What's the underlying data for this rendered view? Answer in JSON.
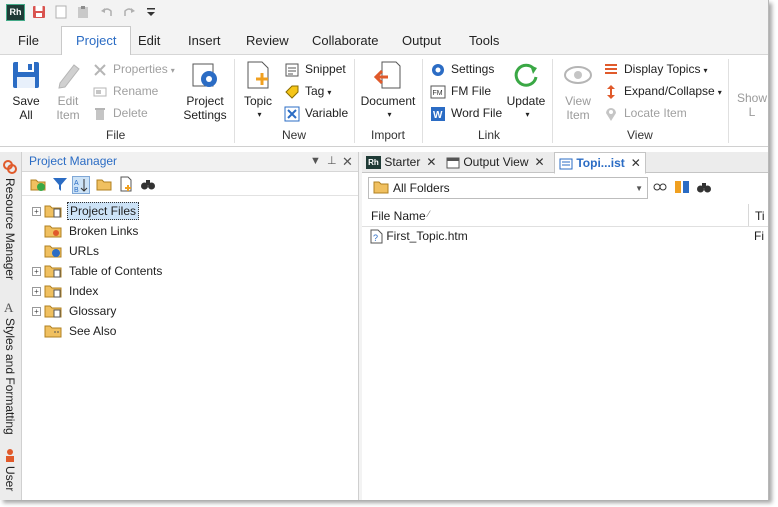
{
  "app": {
    "logo_text": "Rh"
  },
  "menu": {
    "tabs": [
      "File",
      "Project",
      "Edit",
      "Insert",
      "Review",
      "Collaborate",
      "Output",
      "Tools"
    ],
    "active": "Project"
  },
  "ribbon": {
    "file_group": {
      "label": "File",
      "save_all": [
        "Save",
        "All"
      ],
      "edit_item": [
        "Edit",
        "Item"
      ],
      "properties": "Properties",
      "rename": "Rename",
      "delete": "Delete",
      "project_settings": [
        "Project",
        "Settings"
      ]
    },
    "new_group": {
      "label": "New",
      "topic": "Topic",
      "snippet": "Snippet",
      "tag": "Tag",
      "variable": "Variable"
    },
    "import_group": {
      "label": "Import",
      "document": "Document"
    },
    "link_group": {
      "label": "Link",
      "settings": "Settings",
      "fm_file": "FM File",
      "word_file": "Word File",
      "update": "Update"
    },
    "view_group": {
      "label": "View",
      "view_item": [
        "View",
        "Item"
      ],
      "display_topics": "Display Topics",
      "expand_collapse": "Expand/Collapse",
      "locate_item": "Locate Item"
    },
    "overflow_label": [
      "Show",
      "L"
    ]
  },
  "sidebar": {
    "tabs": [
      "Resource Manager",
      "Styles and Formatting",
      "User"
    ]
  },
  "project_manager": {
    "title": "Project Manager",
    "tree": [
      {
        "label": "Project Files",
        "expandable": true,
        "selected": true
      },
      {
        "label": "Broken Links",
        "expandable": false,
        "selected": false
      },
      {
        "label": "URLs",
        "expandable": false,
        "selected": false
      },
      {
        "label": "Table of Contents",
        "expandable": true,
        "selected": false
      },
      {
        "label": "Index",
        "expandable": true,
        "selected": false
      },
      {
        "label": "Glossary",
        "expandable": true,
        "selected": false
      },
      {
        "label": "See Also",
        "expandable": false,
        "selected": false
      }
    ]
  },
  "doc_tabs": [
    {
      "label": "Starter",
      "active": false
    },
    {
      "label": "Output View",
      "active": false
    },
    {
      "label": "Topi...ist",
      "active": true
    }
  ],
  "topic_list": {
    "folder_filter": "All Folders",
    "columns": [
      "File Name",
      "Ti"
    ],
    "rows": [
      {
        "file_name": "First_Topic.htm",
        "title": "Fi"
      }
    ]
  },
  "colors": {
    "accent": "#2b6cc4",
    "selection": "#cde3f7"
  }
}
